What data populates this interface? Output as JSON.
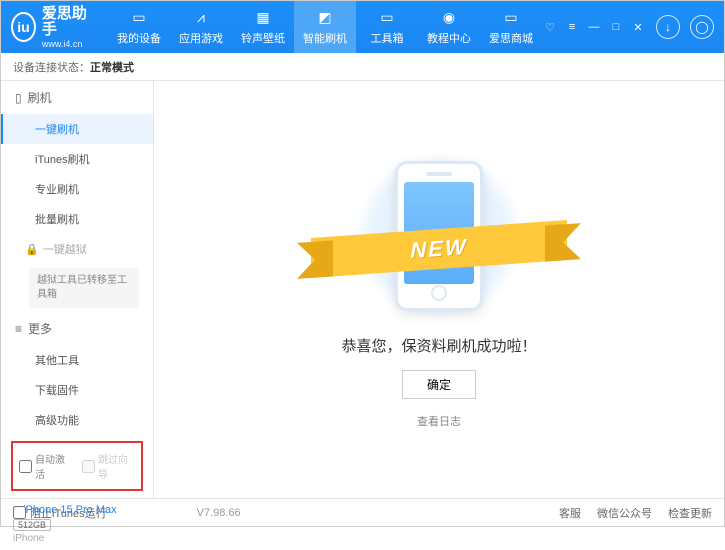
{
  "brand": {
    "name": "爱思助手",
    "site": "www.i4.cn"
  },
  "nav": [
    {
      "label": "我的设备"
    },
    {
      "label": "应用游戏"
    },
    {
      "label": "铃声壁纸"
    },
    {
      "label": "智能刷机"
    },
    {
      "label": "工具箱"
    },
    {
      "label": "教程中心"
    },
    {
      "label": "爱思商城"
    }
  ],
  "status": {
    "prefix": "设备连接状态：",
    "value": "正常模式"
  },
  "sidebar": {
    "flash_head": "刷机",
    "items1": [
      "一键刷机",
      "iTunes刷机",
      "专业刷机",
      "批量刷机"
    ],
    "jailbreak": "一键越狱",
    "jailbreak_note": "越狱工具已转移至工具箱",
    "more_head": "更多",
    "items2": [
      "其他工具",
      "下载固件",
      "高级功能"
    ],
    "opts": {
      "auto_activate": "自动激活",
      "skip_guide": "跳过向导"
    },
    "device": {
      "name": "iPhone 15 Pro Max",
      "capacity": "512GB",
      "model": "iPhone"
    }
  },
  "main": {
    "ribbon": "NEW",
    "success": "恭喜您，保资料刷机成功啦！",
    "ok": "确定",
    "log": "查看日志"
  },
  "footer": {
    "block_itunes": "阻止iTunes运行",
    "version": "V7.98.66",
    "links": [
      "客服",
      "微信公众号",
      "检查更新"
    ]
  }
}
